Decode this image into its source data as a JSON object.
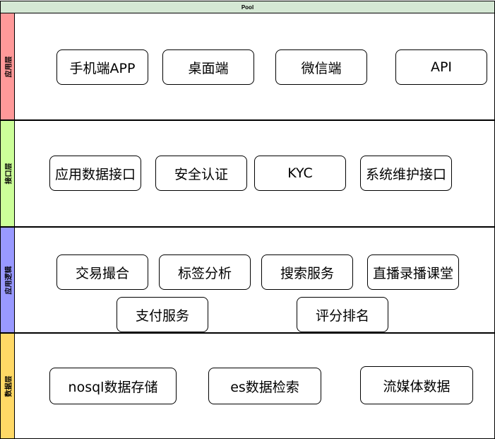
{
  "pool": {
    "title": "Pool"
  },
  "lanes": [
    {
      "label": "应用层",
      "color": "#ff9999",
      "nodes": [
        "手机端APP",
        "桌面端",
        "微信端",
        "API"
      ]
    },
    {
      "label": "接口层",
      "color": "#ccff99",
      "nodes": [
        "应用数据接口",
        "安全认证",
        "KYC",
        "系统维护接口"
      ]
    },
    {
      "label": "应用逻辑",
      "color": "#9999ff",
      "nodes": [
        "交易撮合",
        "标签分析",
        "搜索服务",
        "直播录播课堂",
        "支付服务",
        "评分排名"
      ]
    },
    {
      "label": "数据层",
      "color": "#ffd966",
      "nodes": [
        "nosql数据存储",
        "es数据检索",
        "流媒体数据"
      ]
    }
  ]
}
